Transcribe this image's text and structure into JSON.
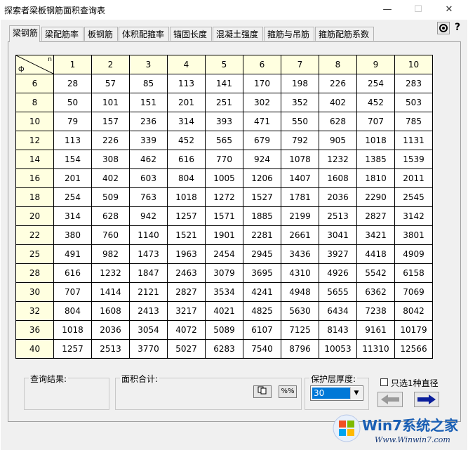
{
  "window": {
    "title": "探索者梁板钢筋面积查询表"
  },
  "tabs": [
    {
      "label": "梁钢筋"
    },
    {
      "label": "梁配筋率"
    },
    {
      "label": "板钢筋"
    },
    {
      "label": "体积配箍率"
    },
    {
      "label": "锚固长度"
    },
    {
      "label": "混凝土强度"
    },
    {
      "label": "箍筋与吊筋"
    },
    {
      "label": "箍筋配筋系数"
    }
  ],
  "table": {
    "corner_top": "n",
    "corner_bottom": "ф",
    "columns": [
      "1",
      "2",
      "3",
      "4",
      "5",
      "6",
      "7",
      "8",
      "9",
      "10"
    ],
    "rows": [
      {
        "d": "6",
        "v": [
          "28",
          "57",
          "85",
          "113",
          "141",
          "170",
          "198",
          "226",
          "254",
          "283"
        ]
      },
      {
        "d": "8",
        "v": [
          "50",
          "101",
          "151",
          "201",
          "251",
          "302",
          "352",
          "402",
          "452",
          "503"
        ]
      },
      {
        "d": "10",
        "v": [
          "79",
          "157",
          "236",
          "314",
          "393",
          "471",
          "550",
          "628",
          "707",
          "785"
        ]
      },
      {
        "d": "12",
        "v": [
          "113",
          "226",
          "339",
          "452",
          "565",
          "679",
          "792",
          "905",
          "1018",
          "1131"
        ]
      },
      {
        "d": "14",
        "v": [
          "154",
          "308",
          "462",
          "616",
          "770",
          "924",
          "1078",
          "1232",
          "1385",
          "1539"
        ]
      },
      {
        "d": "16",
        "v": [
          "201",
          "402",
          "603",
          "804",
          "1005",
          "1206",
          "1407",
          "1608",
          "1810",
          "2011"
        ]
      },
      {
        "d": "18",
        "v": [
          "254",
          "509",
          "763",
          "1018",
          "1272",
          "1527",
          "1781",
          "2036",
          "2290",
          "2545"
        ]
      },
      {
        "d": "20",
        "v": [
          "314",
          "628",
          "942",
          "1257",
          "1571",
          "1885",
          "2199",
          "2513",
          "2827",
          "3142"
        ]
      },
      {
        "d": "22",
        "v": [
          "380",
          "760",
          "1140",
          "1521",
          "1901",
          "2281",
          "2661",
          "3041",
          "3421",
          "3801"
        ]
      },
      {
        "d": "25",
        "v": [
          "491",
          "982",
          "1473",
          "1963",
          "2454",
          "2945",
          "3436",
          "3927",
          "4418",
          "4909"
        ]
      },
      {
        "d": "28",
        "v": [
          "616",
          "1232",
          "1847",
          "2463",
          "3079",
          "3695",
          "4310",
          "4926",
          "5542",
          "6158"
        ]
      },
      {
        "d": "30",
        "v": [
          "707",
          "1414",
          "2121",
          "2827",
          "3534",
          "4241",
          "4948",
          "5655",
          "6362",
          "7069"
        ]
      },
      {
        "d": "32",
        "v": [
          "804",
          "1608",
          "2413",
          "3217",
          "4021",
          "4825",
          "5630",
          "6434",
          "7238",
          "8042"
        ]
      },
      {
        "d": "36",
        "v": [
          "1018",
          "2036",
          "3054",
          "4072",
          "5089",
          "6107",
          "7125",
          "8143",
          "9161",
          "10179"
        ]
      },
      {
        "d": "40",
        "v": [
          "1257",
          "2513",
          "3770",
          "5027",
          "6283",
          "7540",
          "8796",
          "10053",
          "11310",
          "12566"
        ]
      }
    ]
  },
  "query_result": {
    "label": "查询结果:"
  },
  "area_total": {
    "label": "面积合计:",
    "btn2_label": "%%"
  },
  "cover": {
    "label": "保护层厚度:",
    "value": "30"
  },
  "single_diameter": {
    "label": "只选1种直径",
    "checked": false
  },
  "watermark": {
    "brand": "Win7系统之家",
    "url": "Www.Winwin7.com"
  },
  "colors": {
    "header_bg": "#ffffe0",
    "selected_bg": "#0078d7",
    "arrow_active": "#0b1f9c",
    "arrow_disabled": "#9a9a9a"
  }
}
